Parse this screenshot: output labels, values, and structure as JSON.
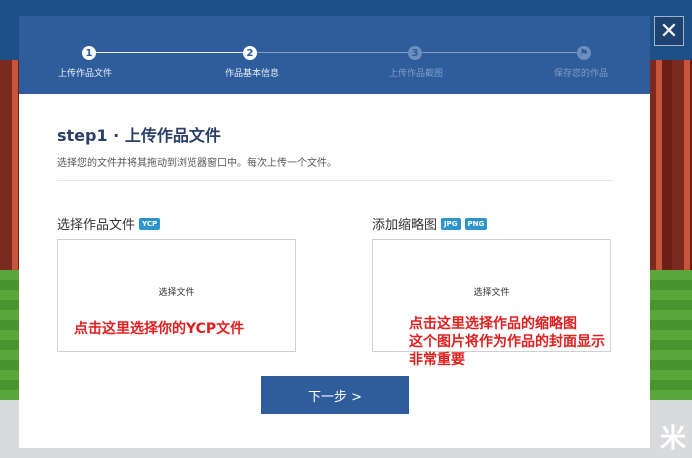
{
  "background": {
    "corner_text": "米"
  },
  "close": {
    "icon": "close-icon",
    "glyph": "✕"
  },
  "steps": [
    {
      "number": "1",
      "label": "上传作品文件",
      "state": "active"
    },
    {
      "number": "2",
      "label": "作品基本信息",
      "state": "active"
    },
    {
      "number": "3",
      "label": "上传作品截图",
      "state": "inactive"
    },
    {
      "number": "⚑",
      "label": "保存您的作品",
      "state": "inactive"
    }
  ],
  "main": {
    "title": "step1 · 上传作品文件",
    "description": "选择您的文件并将其拖动到浏览器窗口中。每次上传一个文件。"
  },
  "upload_file": {
    "label": "选择作品文件",
    "badge": "YCP",
    "choose_text": "选择文件",
    "note": "点击这里选择你的YCP文件"
  },
  "thumbnail": {
    "label": "添加缩略图",
    "badges": [
      "JPG",
      "PNG"
    ],
    "choose_text": "选择文件",
    "note_lines": [
      "点击这里选择作品的缩略图",
      "这个图片将作为作品的封面显示",
      "非常重要"
    ]
  },
  "next_button": {
    "label": "下一步 >"
  },
  "colors": {
    "header": "#2f5d9c",
    "badge": "#2d95c9",
    "note": "#e02020"
  }
}
